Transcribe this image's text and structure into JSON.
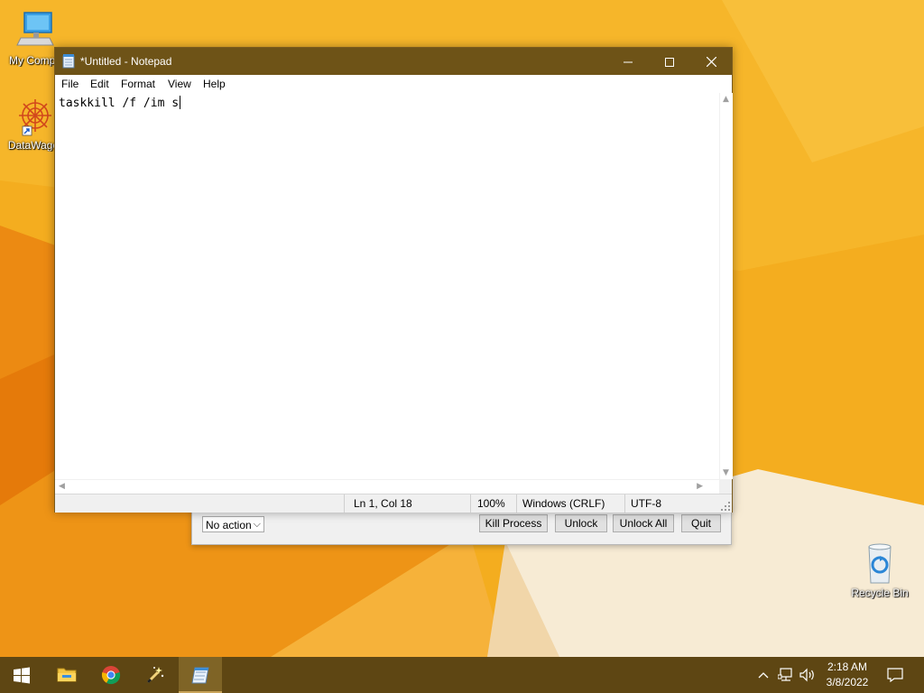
{
  "desktop": {
    "icons": [
      {
        "label": "My Compu",
        "icon": "computer-icon"
      },
      {
        "label": "DataWago",
        "icon": "datawagon-icon"
      },
      {
        "label": "Recycle Bin",
        "icon": "recycle-bin-icon"
      }
    ]
  },
  "unlocker": {
    "action_select": "No action",
    "buttons": [
      "Kill Process",
      "Unlock",
      "Unlock All",
      "Quit"
    ]
  },
  "notepad": {
    "title": "*Untitled - Notepad",
    "menu": [
      "File",
      "Edit",
      "Format",
      "View",
      "Help"
    ],
    "content": "taskkill /f /im s",
    "status": {
      "position": "Ln 1, Col 18",
      "zoom": "100%",
      "line_ending": "Windows (CRLF)",
      "encoding": "UTF-8"
    }
  },
  "taskbar": {
    "items": [
      "start-icon",
      "file-explorer-icon",
      "chrome-icon",
      "wizard-app-icon",
      "notepad-icon"
    ],
    "clock": {
      "time": "2:18 AM",
      "date": "3/8/2022"
    }
  },
  "colors": {
    "wallpaper": "#f2a51c",
    "titlebar": "#6e5317",
    "taskbar": "#5e4613"
  }
}
